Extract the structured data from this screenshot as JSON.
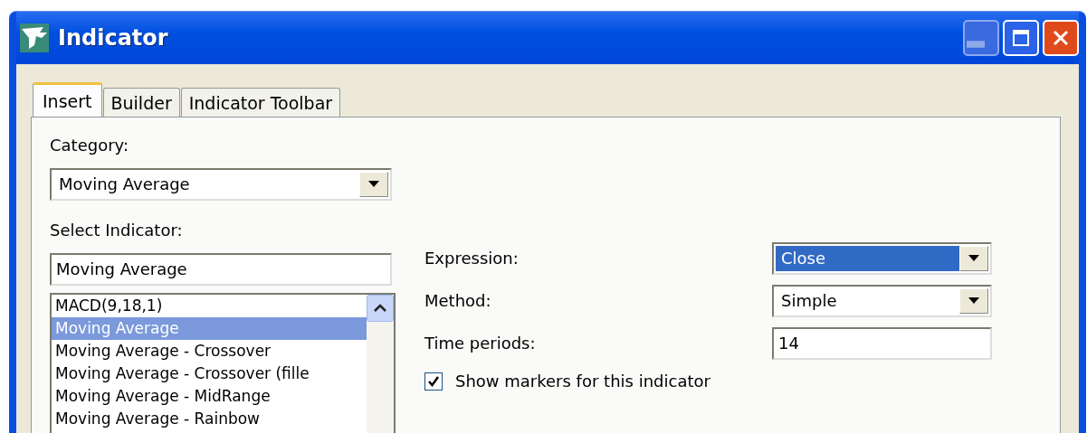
{
  "window": {
    "title": "Indicator"
  },
  "tabs": [
    {
      "label": "Insert",
      "selected": true
    },
    {
      "label": "Builder",
      "selected": false
    },
    {
      "label": "Indicator Toolbar",
      "selected": false
    }
  ],
  "category": {
    "label": "Category:",
    "value": "Moving Average"
  },
  "select_indicator": {
    "label": "Select Indicator:",
    "value": "Moving Average"
  },
  "indicators": [
    {
      "label": "MACD(9,18,1)",
      "selected": false
    },
    {
      "label": "Moving Average",
      "selected": true
    },
    {
      "label": "Moving Average - Crossover",
      "selected": false
    },
    {
      "label": "Moving  Average  -  Crossover (fille",
      "selected": false
    },
    {
      "label": "Moving Average - MidRange",
      "selected": false
    },
    {
      "label": "Moving Average - Rainbow",
      "selected": false
    }
  ],
  "parameters": [
    {
      "kind": "dropdown",
      "label": "Expression:",
      "value": "Close",
      "focused": true
    },
    {
      "kind": "dropdown",
      "label": "Method:",
      "value": "Simple",
      "focused": false
    },
    {
      "kind": "text",
      "label": "Time periods:",
      "value": "14"
    }
  ],
  "show_markers": {
    "label": "Show markers for this indicator",
    "checked": true
  }
}
